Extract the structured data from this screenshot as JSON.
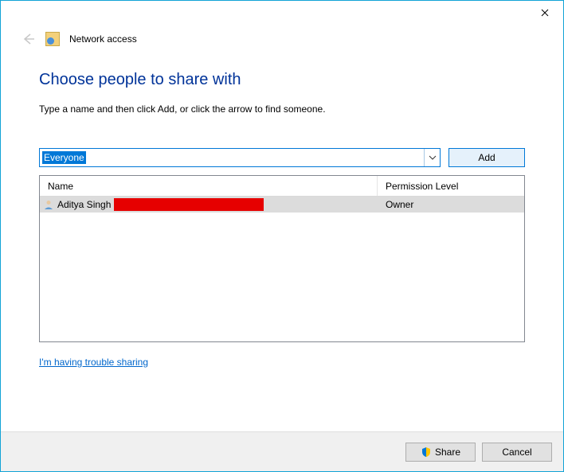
{
  "window": {
    "title": "Network access"
  },
  "main": {
    "heading": "Choose people to share with",
    "instruction": "Type a name and then click Add, or click the arrow to find someone.",
    "combo_value": "Everyone",
    "add_label": "Add",
    "table": {
      "col_name": "Name",
      "col_perm": "Permission Level",
      "rows": [
        {
          "name": "Aditya Singh",
          "perm": "Owner"
        }
      ]
    },
    "trouble_link": "I'm having trouble sharing"
  },
  "footer": {
    "share_label": "Share",
    "cancel_label": "Cancel"
  }
}
